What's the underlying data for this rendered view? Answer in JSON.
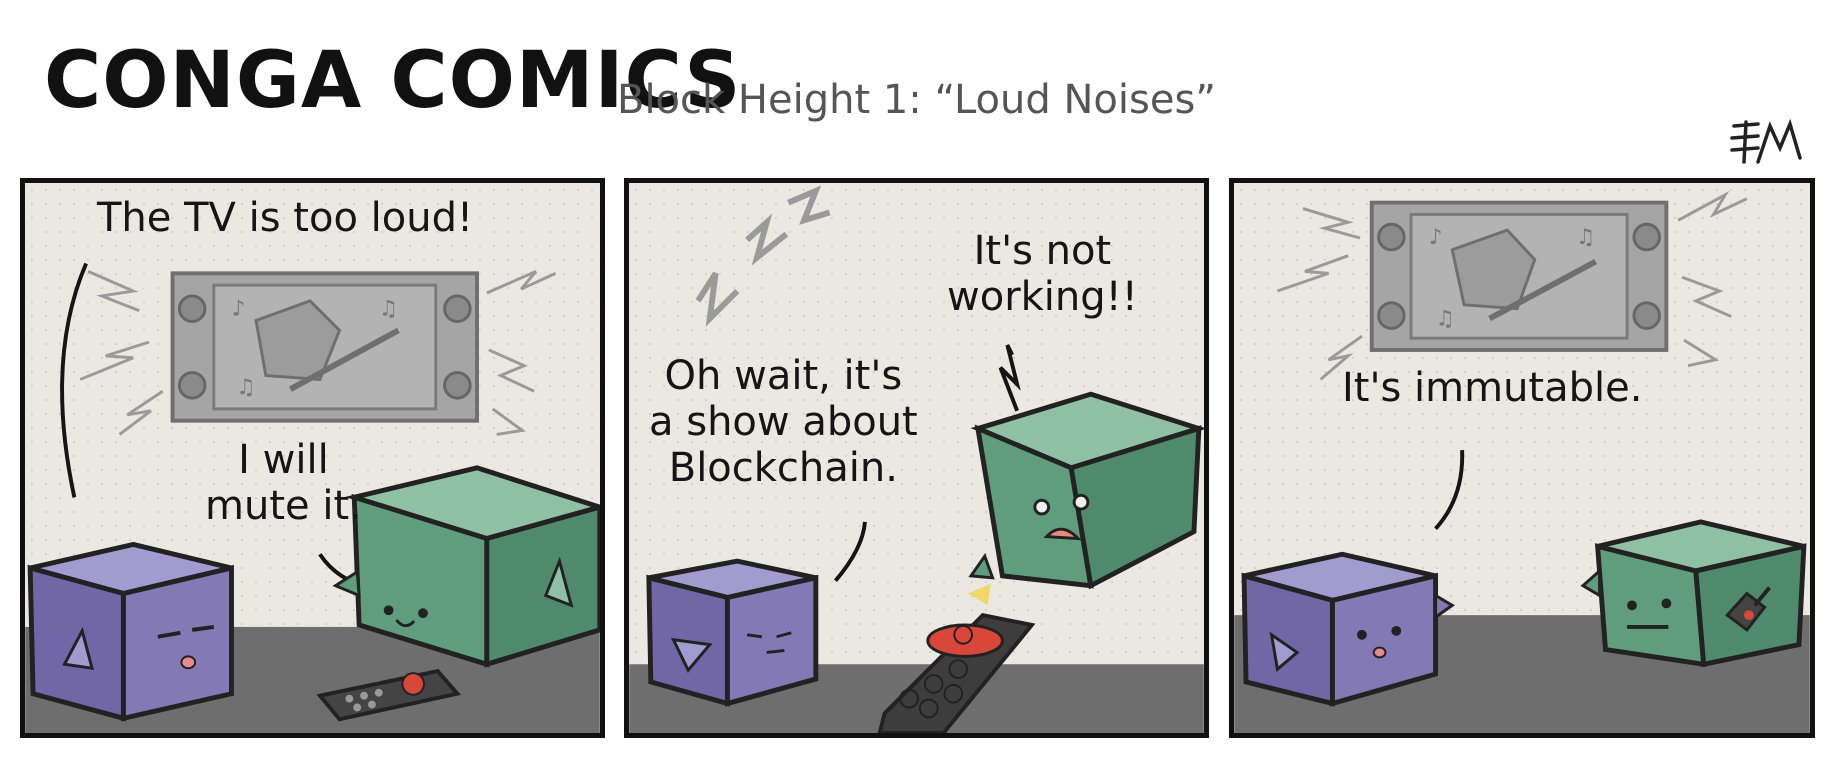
{
  "header": {
    "title": "CONGA COMICS",
    "subtitle": "Block Height 1: “Loud Noises”",
    "signature": "EM"
  },
  "colors": {
    "background": "#ffffff",
    "panel_wall": "#ebe8e2",
    "floor": "#6e6e6e",
    "purple_cube": "#8379b4",
    "green_cube": "#5f9d7d",
    "tv": "#a5a5a5",
    "remote_button": "#d9473a",
    "spark": "#f1d868"
  },
  "panels": [
    {
      "speech": [
        {
          "text": "The TV is too loud!"
        },
        {
          "lines": [
            "I will",
            "mute it."
          ]
        }
      ]
    },
    {
      "speech": [
        {
          "lines": [
            "Oh wait, it's",
            "a show about",
            "Blockchain."
          ]
        },
        {
          "lines": [
            "It's not",
            "working!!"
          ]
        }
      ]
    },
    {
      "speech": [
        {
          "text": "It's immutable."
        }
      ]
    }
  ]
}
